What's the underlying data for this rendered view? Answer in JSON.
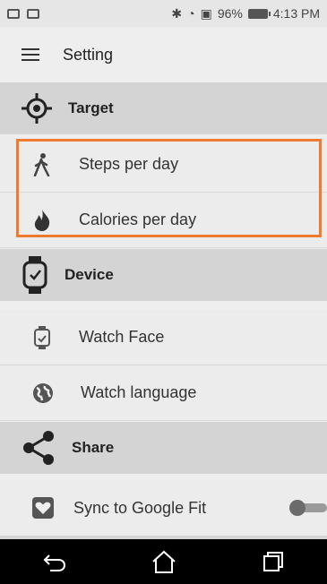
{
  "status_bar": {
    "battery": "96%",
    "time": "4:13 PM"
  },
  "app_bar": {
    "title": "Setting"
  },
  "sections": {
    "target": {
      "label": "Target",
      "icon": "crosshair-icon"
    },
    "device": {
      "label": "Device",
      "icon": "smartwatch-icon"
    },
    "share": {
      "label": "Share",
      "icon": "share-icon"
    }
  },
  "items": {
    "steps": {
      "label": "Steps per day",
      "icon": "walking-icon"
    },
    "calories": {
      "label": "Calories per day",
      "icon": "flame-icon"
    },
    "watch_face": {
      "label": "Watch Face",
      "icon": "watch-face-icon"
    },
    "watch_lang": {
      "label": "Watch language",
      "icon": "globe-icon"
    },
    "sync": {
      "label": "Sync to Google Fit",
      "icon": "heart-icon",
      "toggle_on": false
    }
  },
  "highlight_color": "#f07a2d"
}
